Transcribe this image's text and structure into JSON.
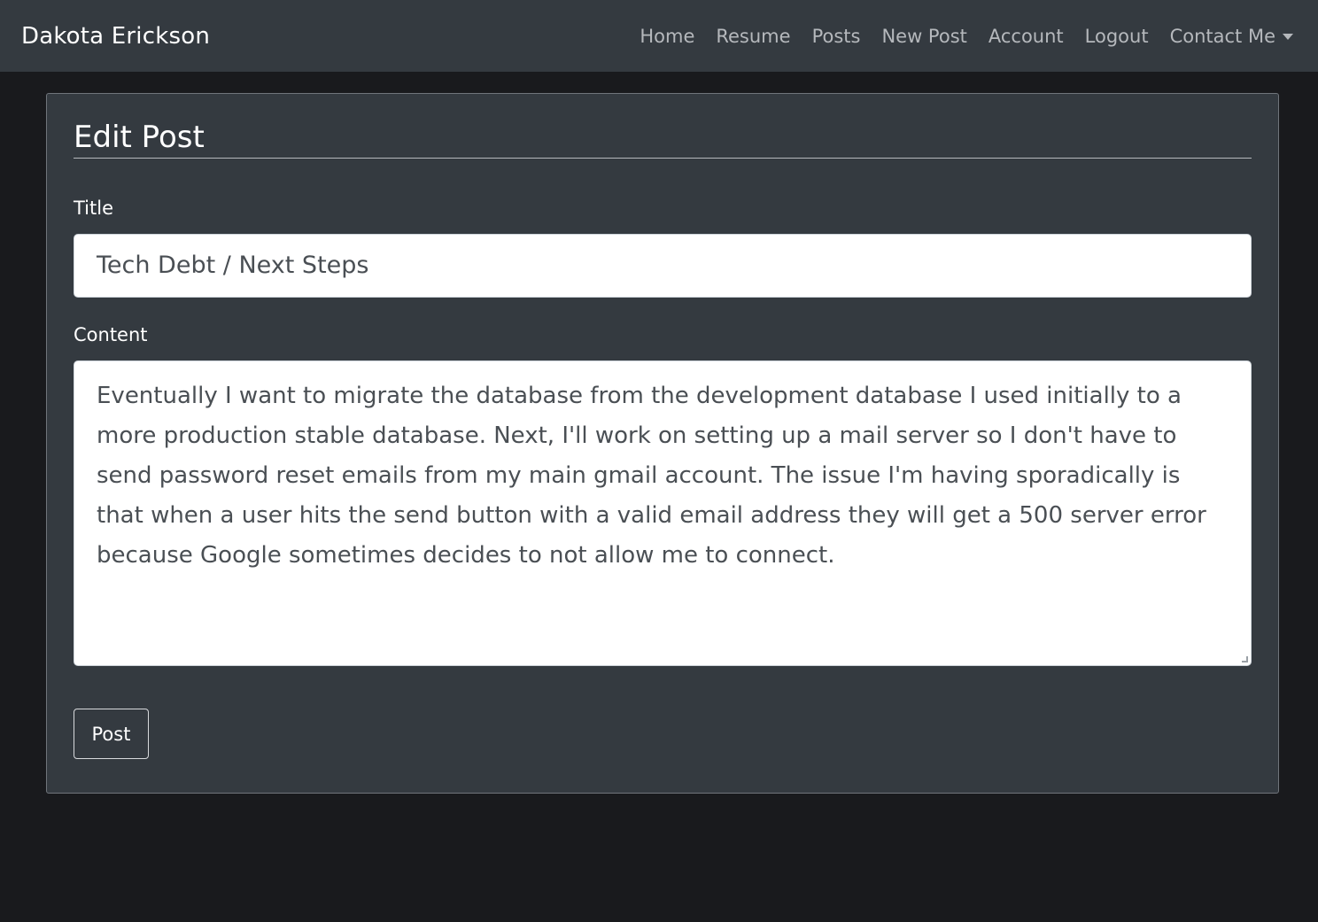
{
  "navbar": {
    "brand": "Dakota Erickson",
    "links": [
      "Home",
      "Resume",
      "Posts",
      "New Post",
      "Account",
      "Logout"
    ],
    "dropdown_label": "Contact Me"
  },
  "form": {
    "legend": "Edit Post",
    "title_label": "Title",
    "title_value": "Tech Debt / Next Steps",
    "content_label": "Content",
    "content_value": "Eventually I want to migrate the database from the development database I used initially to a more production stable database. Next, I'll work on setting up a mail server so I don't have to send password reset emails from my main gmail account. The issue I'm having sporadically is that when a user hits the send button with a valid email address they will get a 500 server error because Google sometimes decides to not allow me to connect.",
    "submit_label": "Post"
  },
  "colors": {
    "navbar_bg": "#343a40",
    "page_bg": "#191a1d",
    "card_bg": "#343a40",
    "nav_link": "#b5b8bc"
  }
}
